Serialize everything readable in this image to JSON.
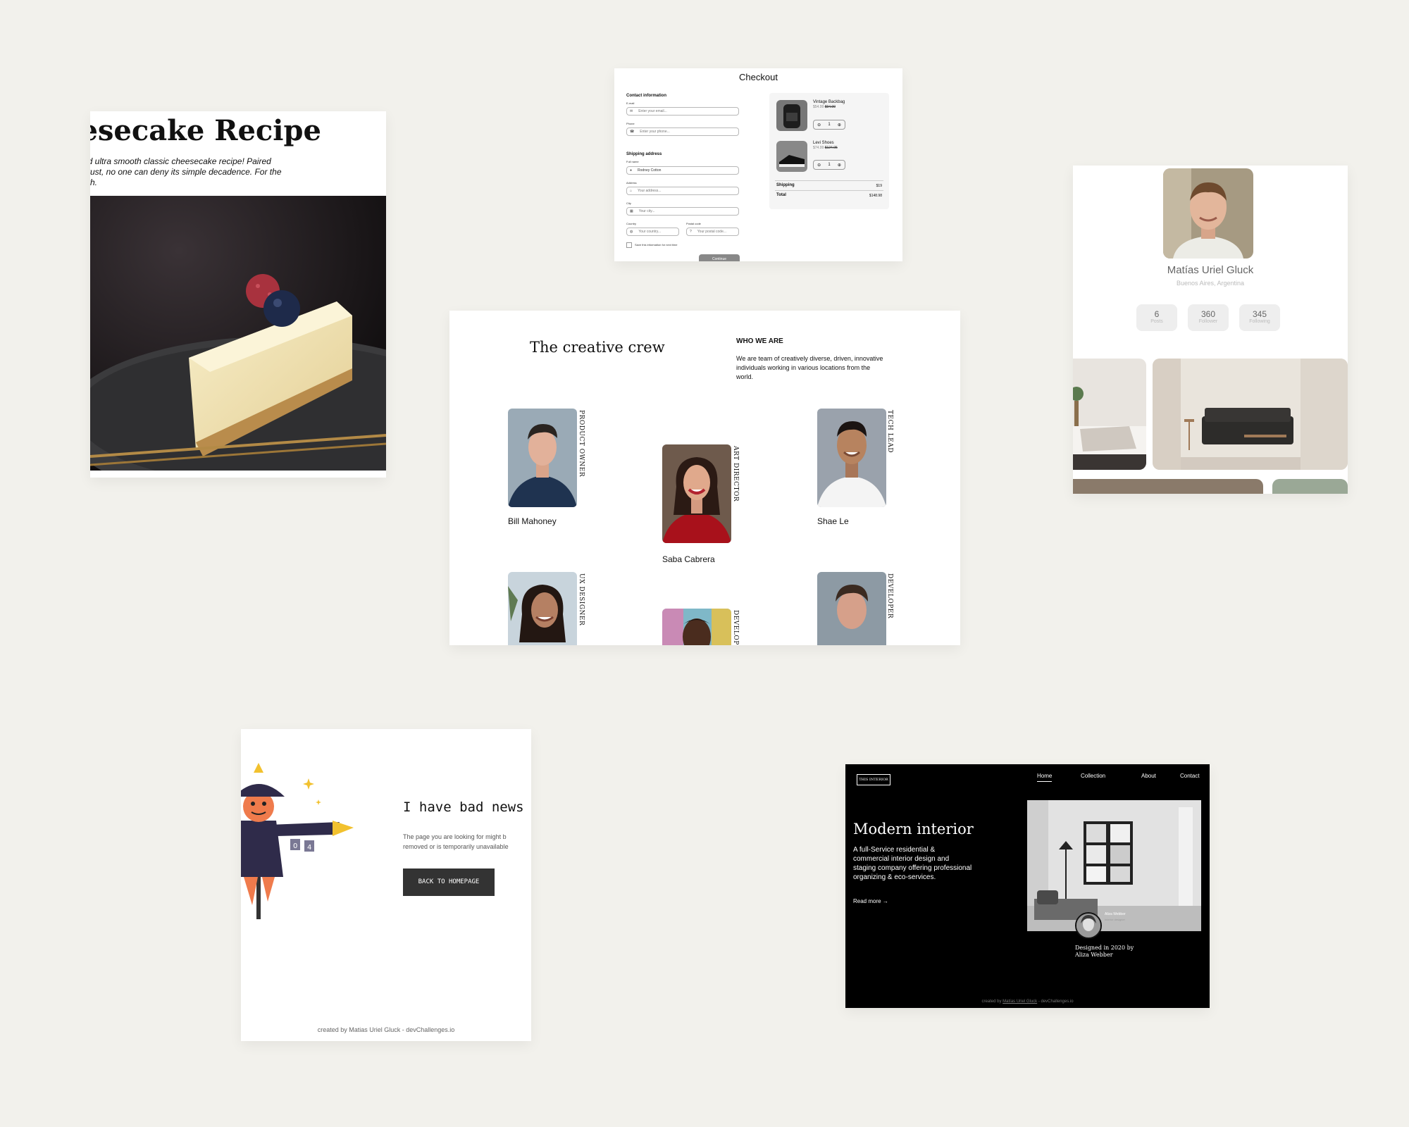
{
  "cheesecake": {
    "title": "eesecake Recipe",
    "description_line1": "nd ultra smooth classic cheesecake recipe! Paired",
    "description_line2": "crust, no one can deny its simple decadence. For the",
    "description_line3": "oth."
  },
  "checkout": {
    "title": "Checkout",
    "contact_heading": "Contact information",
    "email_label": "E-mail",
    "email_placeholder": "Enter your email...",
    "phone_label": "Phone",
    "phone_placeholder": "Enter your phone...",
    "shipping_heading": "Shipping address",
    "fullname_label": "Full name",
    "fullname_value": "Rodney Cotton",
    "address_label": "Address",
    "address_placeholder": "Your address...",
    "city_label": "City",
    "city_placeholder": "Your city...",
    "country_label": "Country",
    "country_placeholder": "Your country...",
    "postal_label": "Postal code",
    "postal_placeholder": "Your postal code...",
    "save_label": "Save this information for next time",
    "continue_label": "Continue",
    "items": [
      {
        "name": "Vintage Backbag",
        "price": "$54.99",
        "old_price": "$94.99",
        "qty": "1"
      },
      {
        "name": "Levi Shoes",
        "price": "$74.99",
        "old_price": "$124.95",
        "qty": "1"
      }
    ],
    "shipping_label": "Shipping",
    "shipping_value": "$19",
    "total_label": "Total",
    "total_value": "$148.98"
  },
  "profile": {
    "name": "Matías Uriel Gluck",
    "location": "Buenos Aires, Argentina",
    "stats": [
      {
        "value": "6",
        "label": "Posts"
      },
      {
        "value": "360",
        "label": "Follower"
      },
      {
        "value": "345",
        "label": "Following"
      }
    ]
  },
  "crew": {
    "title": "The creative crew",
    "who_heading": "WHO WE ARE",
    "who_text": "We are team of creatively diverse, driven, innovative individuals working in various locations from the world.",
    "members": [
      {
        "name": "Bill Mahoney",
        "role": "PRODUCT OWNER"
      },
      {
        "name": "Saba Cabrera",
        "role": "ART DIRECTOR"
      },
      {
        "name": "Shae Le",
        "role": "TECH LEAD"
      },
      {
        "name": "",
        "role": "UX DESIGNER"
      },
      {
        "name": "",
        "role": "DEVELOPER"
      },
      {
        "name": "",
        "role": "DEVELOPER"
      }
    ]
  },
  "notfound": {
    "headline": "I have bad news f",
    "sub_line1": "The page you are looking for might b",
    "sub_line2": "removed or is temporarily unavailable",
    "button_label": "BACK TO HOMEPAGE",
    "credit": "created by Matias Uriel Gluck - devChallenges.io"
  },
  "interior": {
    "logo": "THIS INTERIOR",
    "nav": [
      "Home",
      "Collection",
      "About",
      "Contact"
    ],
    "hero_title": "Modern interior",
    "hero_text": "A full-Service residential & commercial interior design and staging company offering professional organizing & eco-services.",
    "read_more": "Read more",
    "designer_name": "Aliza Webber",
    "designer_role": "Interior designer",
    "designed_by": "Designed in 2020 by Aliza Webber",
    "credit_prefix": "created by",
    "credit_name": "Matías Uriel Gluck",
    "credit_suffix": "- devChallenges.io"
  }
}
